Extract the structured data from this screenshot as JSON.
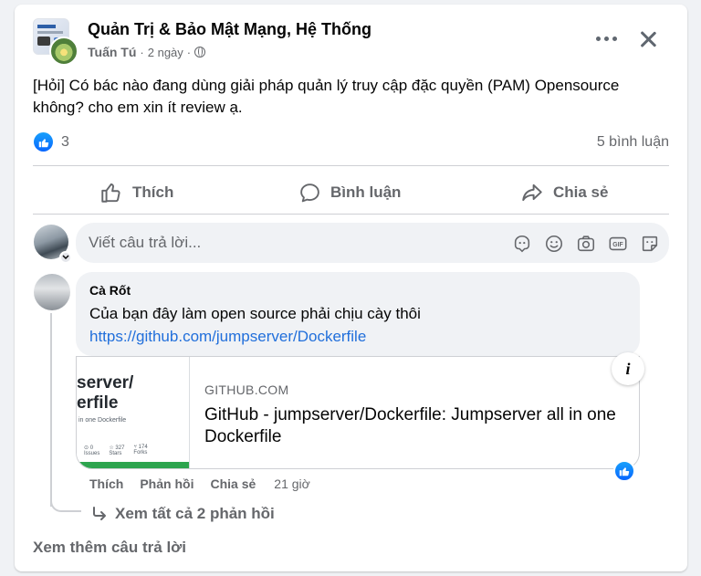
{
  "post": {
    "group_name": "Quản Trị & Bảo Mật Mạng, Hệ Thống",
    "author": "Tuấn Tú",
    "time": "2 ngày",
    "separator": "·",
    "text": "[Hỏi] Có bác nào đang dùng giải pháp quản lý truy cập đặc quyền (PAM) Opensource không? cho em xin ít review ạ.",
    "like_count": "3",
    "comment_count": "5 bình luận"
  },
  "actions": {
    "like": "Thích",
    "comment": "Bình luận",
    "share": "Chia sẻ"
  },
  "composer": {
    "placeholder": "Viết câu trả lời..."
  },
  "comment": {
    "name": "Cà Rốt",
    "text": "Của bạn đây làm open source phải chịu cày thôi",
    "link": "https://github.com/jumpserver/Dockerfile",
    "preview": {
      "image_line1": "server/",
      "image_line2": "erfile",
      "image_line3": "in one Dockerfile",
      "image_stats": [
        "⊙ 0",
        "☆ 327",
        "⑂ 174"
      ],
      "image_stat_labels": [
        "Issues",
        "Stars",
        "Forks"
      ],
      "domain": "GITHUB.COM",
      "title": "GitHub - jumpserver/Dockerfile: Jumpserver all in one Dockerfile",
      "info_label": "i"
    },
    "meta": {
      "like": "Thích",
      "reply": "Phản hồi",
      "share": "Chia sẻ",
      "time": "21 giờ"
    },
    "view_replies": "Xem tất cả 2 phản hồi"
  },
  "footer": {
    "more_comments": "Xem thêm câu trả lời"
  },
  "colors": {
    "accent": "#0866ff",
    "link": "#216fdb",
    "secondary_text": "#65676b",
    "bubble": "#f0f2f5"
  }
}
